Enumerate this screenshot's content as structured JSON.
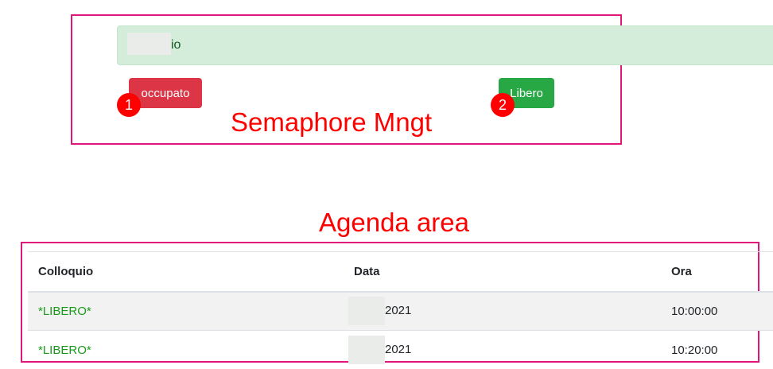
{
  "semaphore": {
    "message_suffix": "io",
    "occupato_label": "occupato",
    "libero_label": "Libero",
    "badge_1": "1",
    "badge_2": "2",
    "annotation": "Semaphore Mngt"
  },
  "agenda": {
    "annotation": "Agenda area",
    "headers": [
      "Colloquio",
      "Data",
      "Ora"
    ],
    "rows": [
      {
        "colloquio": "*LIBERO*",
        "data_suffix": "2021",
        "ora": "10:00:00"
      },
      {
        "colloquio": "*LIBERO*",
        "data_suffix": "2021",
        "ora": "10:20:00"
      }
    ]
  },
  "colors": {
    "annotation": "#ff0000",
    "annotation_border": "#e0167a",
    "danger": "#dc3545",
    "success": "#28a745",
    "alert_bg": "#d4edda"
  }
}
